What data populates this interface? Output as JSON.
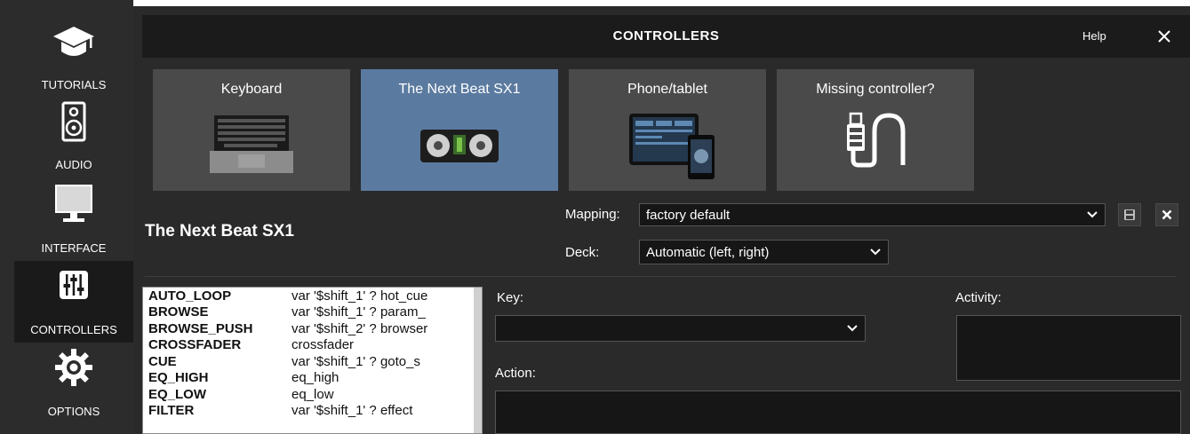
{
  "sidebar": {
    "items": [
      {
        "label": "TUTORIALS",
        "icon": "graduation-cap-icon"
      },
      {
        "label": "AUDIO",
        "icon": "speaker-icon"
      },
      {
        "label": "INTERFACE",
        "icon": "monitor-icon"
      },
      {
        "label": "CONTROLLERS",
        "icon": "mixer-sliders-icon",
        "active": true
      },
      {
        "label": "OPTIONS",
        "icon": "gear-icon"
      }
    ]
  },
  "header": {
    "title": "CONTROLLERS",
    "help": "Help",
    "close_icon": "close-icon"
  },
  "controllers": [
    {
      "label": "Keyboard",
      "icon": "keyboard-icon"
    },
    {
      "label": "The Next Beat SX1",
      "icon": "dj-controller-icon",
      "selected": true
    },
    {
      "label": "Phone/tablet",
      "icon": "phone-tablet-icon"
    },
    {
      "label": "Missing controller?",
      "icon": "usb-cable-icon"
    }
  ],
  "controller": {
    "name": "The Next Beat SX1",
    "mapping_label": "Mapping:",
    "mapping_value": "factory default",
    "deck_label": "Deck:",
    "deck_value": "Automatic (left, right)",
    "save_icon": "save-icon",
    "delete_icon": "close-icon"
  },
  "mappings": [
    {
      "key": "AUTO_LOOP",
      "action": "var '$shift_1' ? hot_cue"
    },
    {
      "key": "BROWSE",
      "action": "var '$shift_1' ? param_"
    },
    {
      "key": "BROWSE_PUSH",
      "action": "var '$shift_2' ? browser"
    },
    {
      "key": "CROSSFADER",
      "action": "crossfader"
    },
    {
      "key": "CUE",
      "action": "var '$shift_1' ? goto_s"
    },
    {
      "key": "EQ_HIGH",
      "action": "eq_high"
    },
    {
      "key": "EQ_LOW",
      "action": "eq_low"
    },
    {
      "key": "FILTER",
      "action": "var '$shift_1' ? effect"
    }
  ],
  "editor": {
    "key_label": "Key:",
    "key_value": "",
    "action_label": "Action:",
    "activity_label": "Activity:"
  },
  "colors": {
    "sidebar_bg": "#2c2c2c",
    "panel_bg": "#2a2a2a",
    "tile_bg": "#4a4a4a",
    "tile_selected": "#5b7aa0"
  }
}
